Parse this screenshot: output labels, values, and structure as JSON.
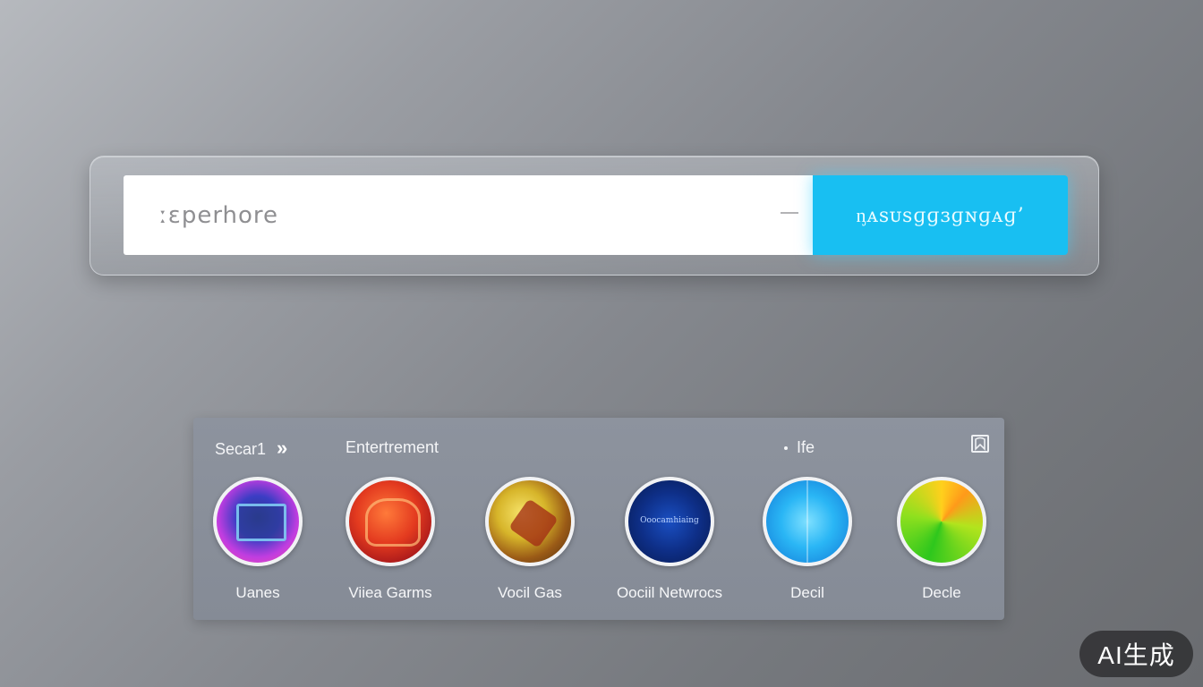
{
  "search": {
    "value": "ːɛperhore",
    "button_label": "ᶇᴀsᴜsɡɡɜɡɴɡᴀɡ’"
  },
  "panel": {
    "header": {
      "search_label": "Secar1",
      "chevrons": "»",
      "entertainment_label": "Entertrement",
      "life_label": "Ife"
    },
    "categories": [
      {
        "label": "Uanes",
        "icon": "gradient-screen-icon"
      },
      {
        "label": "Viiea Garms",
        "icon": "video-game-icon"
      },
      {
        "label": "Vocil Gas",
        "icon": "artwork-icon"
      },
      {
        "label": "Oociil Netwrocs",
        "icon": "social-network-icon",
        "inner_text": "Ooocamhiaing"
      },
      {
        "label": "Decil",
        "icon": "blue-pattern-icon"
      },
      {
        "label": "Decle",
        "icon": "green-gem-icon"
      }
    ]
  },
  "badge": {
    "label": "AI生成"
  },
  "colors": {
    "accent": "#18bff2",
    "panel": "#8a909b",
    "field": "#ffffff"
  }
}
